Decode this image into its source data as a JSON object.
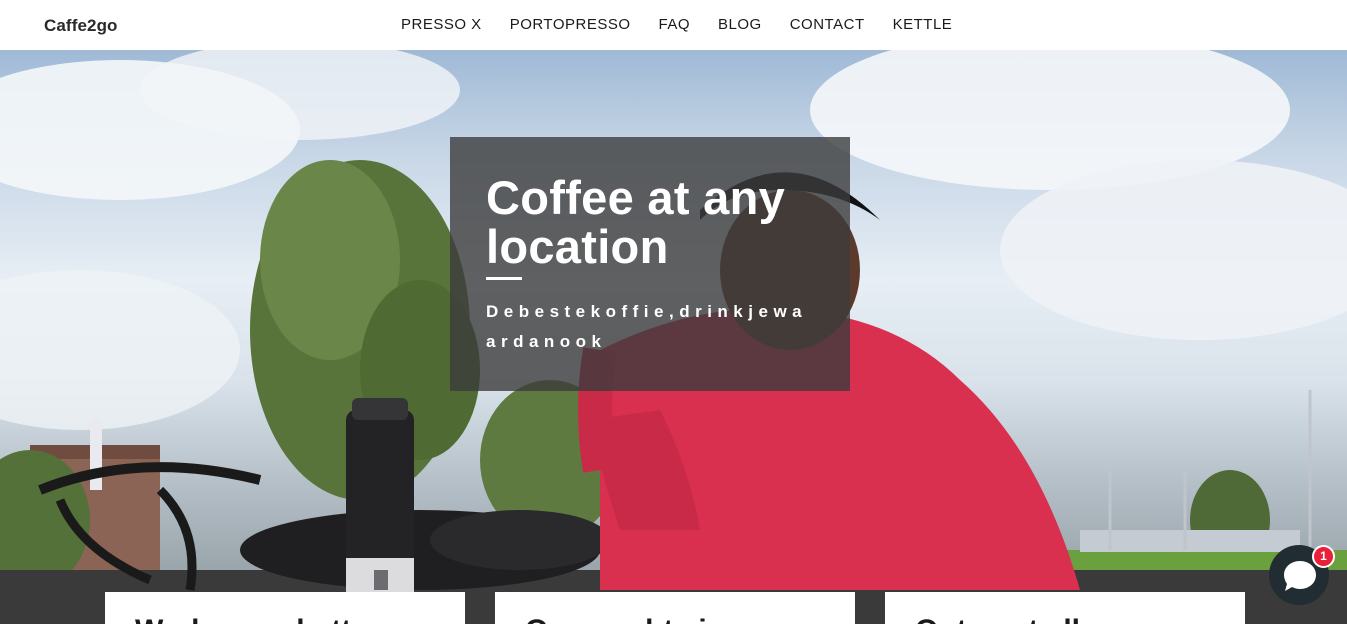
{
  "header": {
    "logo": "Caffe2go",
    "nav": [
      "PRESSO X",
      "PORTOPRESSO",
      "FAQ",
      "BLOG",
      "CONTACT",
      "KETTLE"
    ]
  },
  "hero": {
    "title": "Coffee at any location",
    "subtitle": "Debestekoffie,drinkjewaardanook"
  },
  "cards": [
    {
      "title": "Werk overal otter"
    },
    {
      "title": "Overnacht vier"
    },
    {
      "title": "Ontmoet elkaar"
    }
  ],
  "chat": {
    "badge": "1",
    "icon": "chat-bubble-icon"
  },
  "colors": {
    "overlay": "#3c3c3c",
    "jersey": "#d9304f",
    "chat": "#222d33",
    "badge": "#e8203a"
  }
}
